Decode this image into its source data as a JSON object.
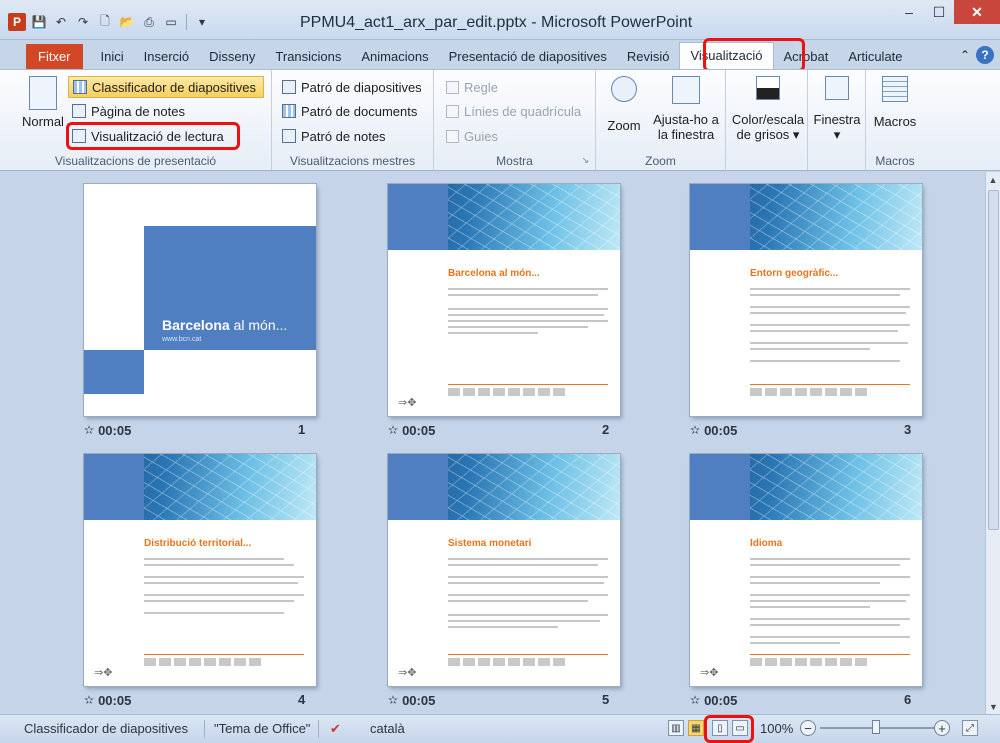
{
  "window": {
    "title": "PPMU4_act1_arx_par_edit.pptx - Microsoft PowerPoint"
  },
  "qat": {
    "app_letter": "P"
  },
  "tabs": [
    {
      "label": "Fitxer"
    },
    {
      "label": "Inici"
    },
    {
      "label": "Inserció"
    },
    {
      "label": "Disseny"
    },
    {
      "label": "Transicions"
    },
    {
      "label": "Animacions"
    },
    {
      "label": "Presentació de diapositives"
    },
    {
      "label": "Revisió"
    },
    {
      "label": "Visualització"
    },
    {
      "label": "Acrobat"
    },
    {
      "label": "Articulate"
    }
  ],
  "ribbon": {
    "presentation_views": {
      "label": "Visualitzacions de presentació",
      "normal": "Normal",
      "slide_sorter": "Classificador de diapositives",
      "notes_page": "Pàgina de notes",
      "reading_view": "Visualització de lectura"
    },
    "master_views": {
      "label": "Visualitzacions mestres",
      "slide_master": "Patró de diapositives",
      "handout_master": "Patró de documents",
      "notes_master": "Patró de notes"
    },
    "show": {
      "label": "Mostra",
      "ruler": "Regle",
      "gridlines": "Línies de quadrícula",
      "guides": "Guies"
    },
    "zoom": {
      "label": "Zoom",
      "zoom": "Zoom",
      "fit_line1": "Ajusta-ho a",
      "fit_line2": "la finestra"
    },
    "color": {
      "line1": "Color/escala",
      "line2": "de grisos"
    },
    "window": {
      "label": "Finestra"
    },
    "macros": {
      "label": "Macros",
      "button": "Macros"
    }
  },
  "slides": [
    {
      "number": "1",
      "time": "00:05",
      "title": "Barcelona",
      "title_rest": " al món...",
      "url": "www.bcn.cat"
    },
    {
      "number": "2",
      "time": "00:05",
      "title": "Barcelona al món..."
    },
    {
      "number": "3",
      "time": "00:05",
      "title": "Entorn geogràfic..."
    },
    {
      "number": "4",
      "time": "00:05",
      "title": "Distribució territorial..."
    },
    {
      "number": "5",
      "time": "00:05",
      "title": "Sistema monetari"
    },
    {
      "number": "6",
      "time": "00:05",
      "title": "Idioma"
    }
  ],
  "statusbar": {
    "view": "Classificador de diapositives",
    "theme": "\"Tema de Office\"",
    "language": "català",
    "zoom": "100%"
  },
  "colors": {
    "accent_orange": "#e8741c",
    "file_tab": "#d24726",
    "highlight_red": "#e11111",
    "slide_blue": "#4f7fc0"
  }
}
